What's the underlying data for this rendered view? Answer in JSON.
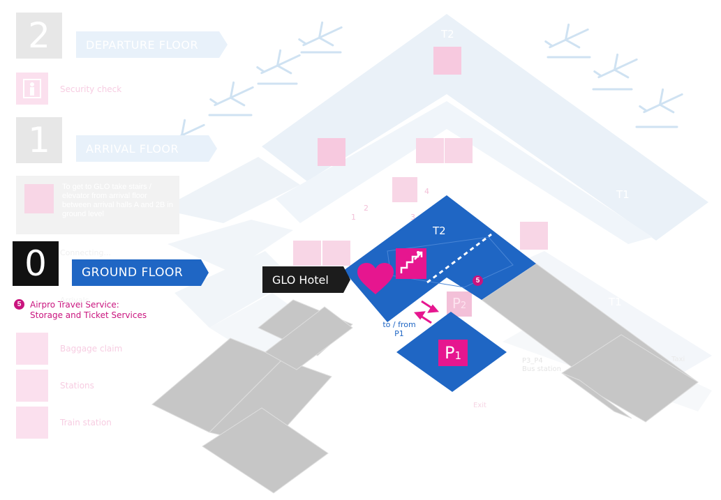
{
  "floors": [
    {
      "number": "2",
      "name": "DEPARTURE FLOOR",
      "active": false
    },
    {
      "number": "1",
      "name": "ARRIVAL FLOOR",
      "active": false
    },
    {
      "number": "0",
      "name": "GROUND FLOOR",
      "active": true
    }
  ],
  "legend_upper": {
    "security_check": "Security check"
  },
  "faded_note": "To get to GLO take stairs / elevator from arrival floor between arrival halls A and 2B in ground level",
  "legend_lower": {
    "airpro_number": "5",
    "airpro_title": "Airpro Travel Service:",
    "airpro_subtitle": "Storage and Ticket Services",
    "baggage_claim": "Baggage claim",
    "stations": "Stations",
    "train_station": "Train station",
    "faded_line1": "Connecting...",
    "faded_line2": "Arrivals..."
  },
  "map": {
    "t2_top": "T2",
    "t2_mid": "T2",
    "t2_blue": "T2",
    "t1_upper": "T1",
    "t1_lower": "T1",
    "hotel_callout": "GLO Hotel",
    "badge_5": "5",
    "to_from_line1": "to / from",
    "to_from_line2": "P1",
    "p1_main": "P",
    "p1_sub": "1",
    "p2_main": "P",
    "p2_sub": "2",
    "faded_p3": "P3_P4",
    "faded_p3_line2": "Bus station",
    "faded_exit": "Exit",
    "faded_taxi": "Taxi",
    "faded_nums": [
      "1",
      "2",
      "3",
      "4"
    ]
  },
  "colors": {
    "blue": "#1f66c4",
    "magenta": "#e6168f",
    "grey": "#c6c6c6",
    "dark": "#1c1c1c"
  },
  "icons": [
    "security-check-icon",
    "stairs-icon",
    "heart-icon",
    "baggage-claim-icon",
    "station-icon",
    "train-icon",
    "airplane-icon",
    "parking-icon"
  ]
}
